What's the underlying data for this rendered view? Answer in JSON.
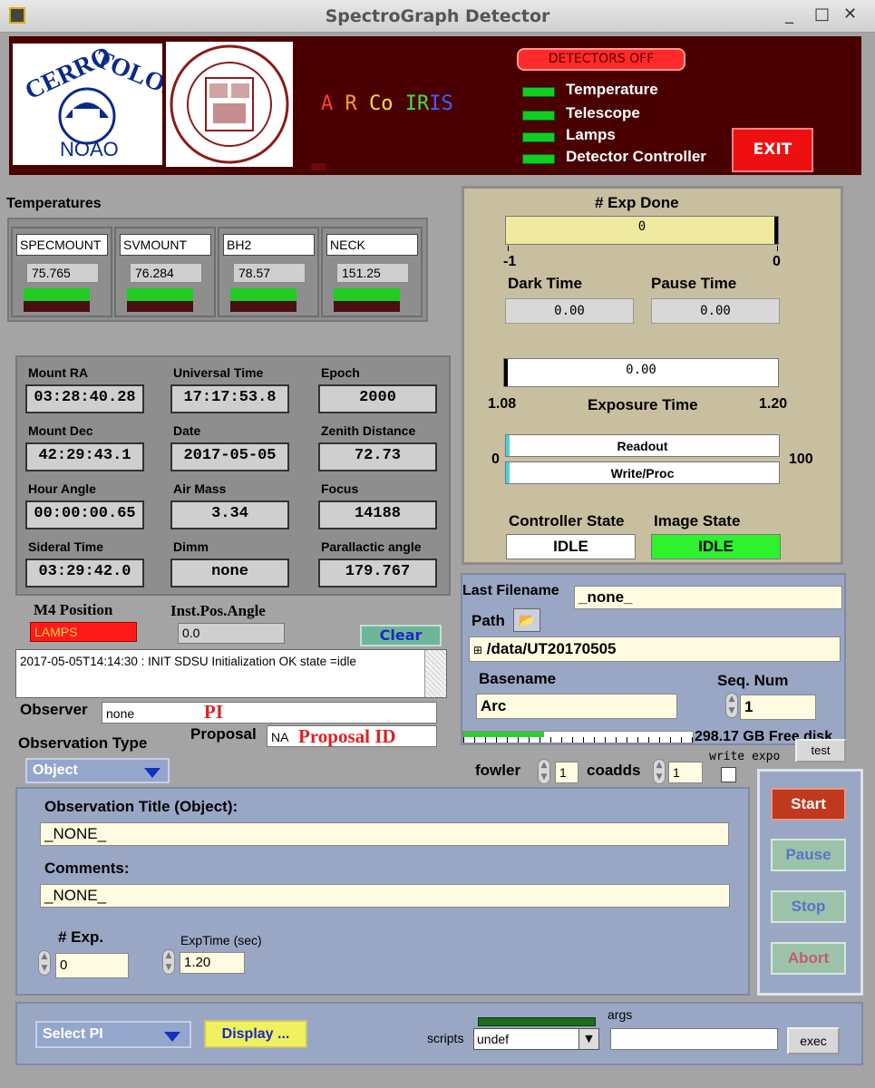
{
  "window": {
    "title": "SpectroGraph Detector"
  },
  "banner": {
    "detectors_off": "DETECTORS OFF",
    "status": [
      "Temperature",
      "Telescope",
      "Lamps",
      "Detector Controller"
    ],
    "exit": "EXIT",
    "arcoiris": [
      "A",
      "R",
      "Co",
      "IR",
      "IS"
    ]
  },
  "temps": {
    "title": "Temperatures",
    "sensors": [
      {
        "name": "SPECMOUNT",
        "value": "75.765"
      },
      {
        "name": "SVMOUNT",
        "value": "76.284"
      },
      {
        "name": "BH2",
        "value": "78.57"
      },
      {
        "name": "NECK",
        "value": "151.25"
      }
    ]
  },
  "telescope": [
    {
      "label": "Mount RA",
      "value": "03:28:40.28"
    },
    {
      "label": "Universal Time",
      "value": "17:17:53.8"
    },
    {
      "label": "Epoch",
      "value": "2000"
    },
    {
      "label": "Mount Dec",
      "value": "42:29:43.1"
    },
    {
      "label": "Date",
      "value": "2017-05-05"
    },
    {
      "label": "Zenith Distance",
      "value": "72.73"
    },
    {
      "label": "Hour Angle",
      "value": "00:00:00.65"
    },
    {
      "label": "Air Mass",
      "value": "3.34"
    },
    {
      "label": "Focus",
      "value": "14188"
    },
    {
      "label": "Sideral Time",
      "value": "03:29:42.0"
    },
    {
      "label": "Dimm",
      "value": "none"
    },
    {
      "label": "Parallactic angle",
      "value": "179.767"
    }
  ],
  "m4": {
    "label": "M4 Position",
    "value": "LAMPS"
  },
  "inst": {
    "label": "Inst.Pos.Angle",
    "value": "0.0"
  },
  "clear": "Clear",
  "log": "2017-05-05T14:14:30 : INIT SDSU Initialization OK state =idle",
  "observer": {
    "label": "Observer",
    "value": "none",
    "annot": "PI"
  },
  "proposal": {
    "label": "Proposal",
    "value": "NA",
    "annot": "Proposal ID"
  },
  "obstype": {
    "label": "Observation Type",
    "value": "Object"
  },
  "exposure": {
    "exp_done_label": "# Exp Done",
    "exp_done": "0",
    "exp_done_fill": 0,
    "min": "-1",
    "max": "0",
    "dark_label": "Dark Time",
    "dark": "0.00",
    "pause_label": "Pause Time",
    "pause": "0.00",
    "exp_value": "0.00",
    "exp_min": "1.08",
    "exp_label": "Exposure Time",
    "exp_max": "1.20",
    "rw_min": "0",
    "rw_max": "100",
    "readout": "Readout",
    "write": "Write/Proc",
    "ctrl_label": "Controller State",
    "ctrl": "IDLE",
    "img_label": "Image State",
    "img": "IDLE"
  },
  "file": {
    "last_label": "Last Filename",
    "last": "_none_",
    "path_label": "Path",
    "path": "/data/UT20170505",
    "base_label": "Basename",
    "base": "Arc",
    "seq_label": "Seq. Num",
    "seq": "1",
    "disk": "298.17 GB Free disk",
    "disk_fill": 0.35,
    "write_expo": "write expo",
    "test": "test",
    "fowler_label": "fowler",
    "fowler": "1",
    "coadds_label": "coadds",
    "coadds": "1"
  },
  "obs": {
    "title_label": "Observation Title (Object):",
    "title": "_NONE_",
    "comments_label": "Comments:",
    "comments": "_NONE_",
    "nexp_label": "# Exp.",
    "nexp": "0",
    "exptime_label": "ExpTime (sec)",
    "exptime": "1.20"
  },
  "controls": {
    "start": "Start",
    "pause": "Pause",
    "stop": "Stop",
    "abort": "Abort"
  },
  "bottom": {
    "select_pi": "Select PI",
    "display": "Display ...",
    "args": "args",
    "scripts_label": "scripts",
    "scripts": "undef",
    "exec": "exec"
  }
}
